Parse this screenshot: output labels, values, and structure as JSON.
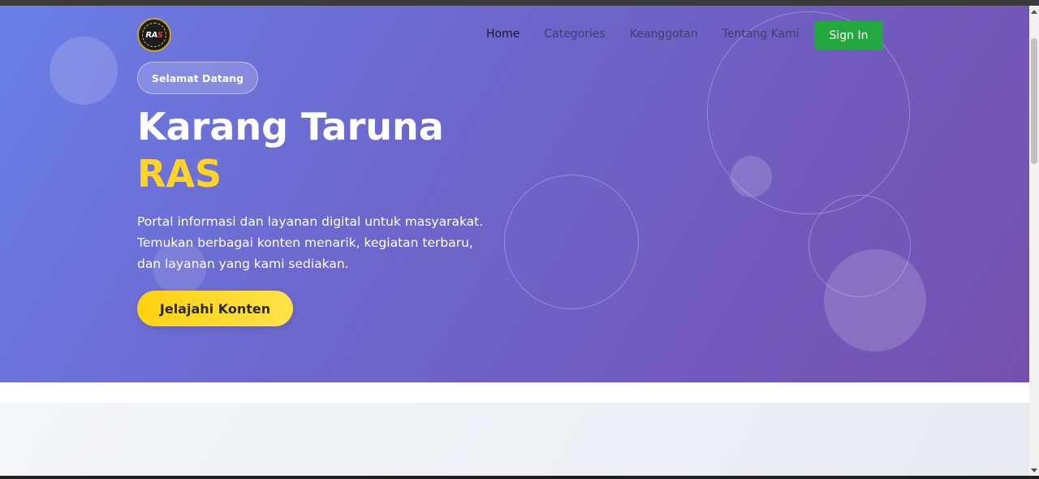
{
  "nav": {
    "logo": {
      "icon": "ras-logo-icon",
      "text_main": "RA",
      "text_accent": "S"
    },
    "items": [
      {
        "label": "Home",
        "active": true
      },
      {
        "label": "Categories",
        "active": false
      },
      {
        "label": "Keanggotan",
        "active": false
      },
      {
        "label": "Tentang Kami",
        "active": false
      }
    ],
    "signin_label": "Sign In"
  },
  "hero": {
    "badge": "Selamat Datang",
    "title_line1": "Karang Taruna",
    "title_line2": "RAS",
    "description": "Portal informasi dan layanan digital untuk masyarakat. Temukan berbagai konten menarik, kegiatan terbaru, dan layanan yang kami sediakan.",
    "cta_label": "Jelajahi Konten"
  },
  "colors": {
    "gradient_start": "#6a7ee8",
    "gradient_end": "#7550b0",
    "accent_yellow": "#ffd426",
    "signin_green": "#22a83e"
  }
}
